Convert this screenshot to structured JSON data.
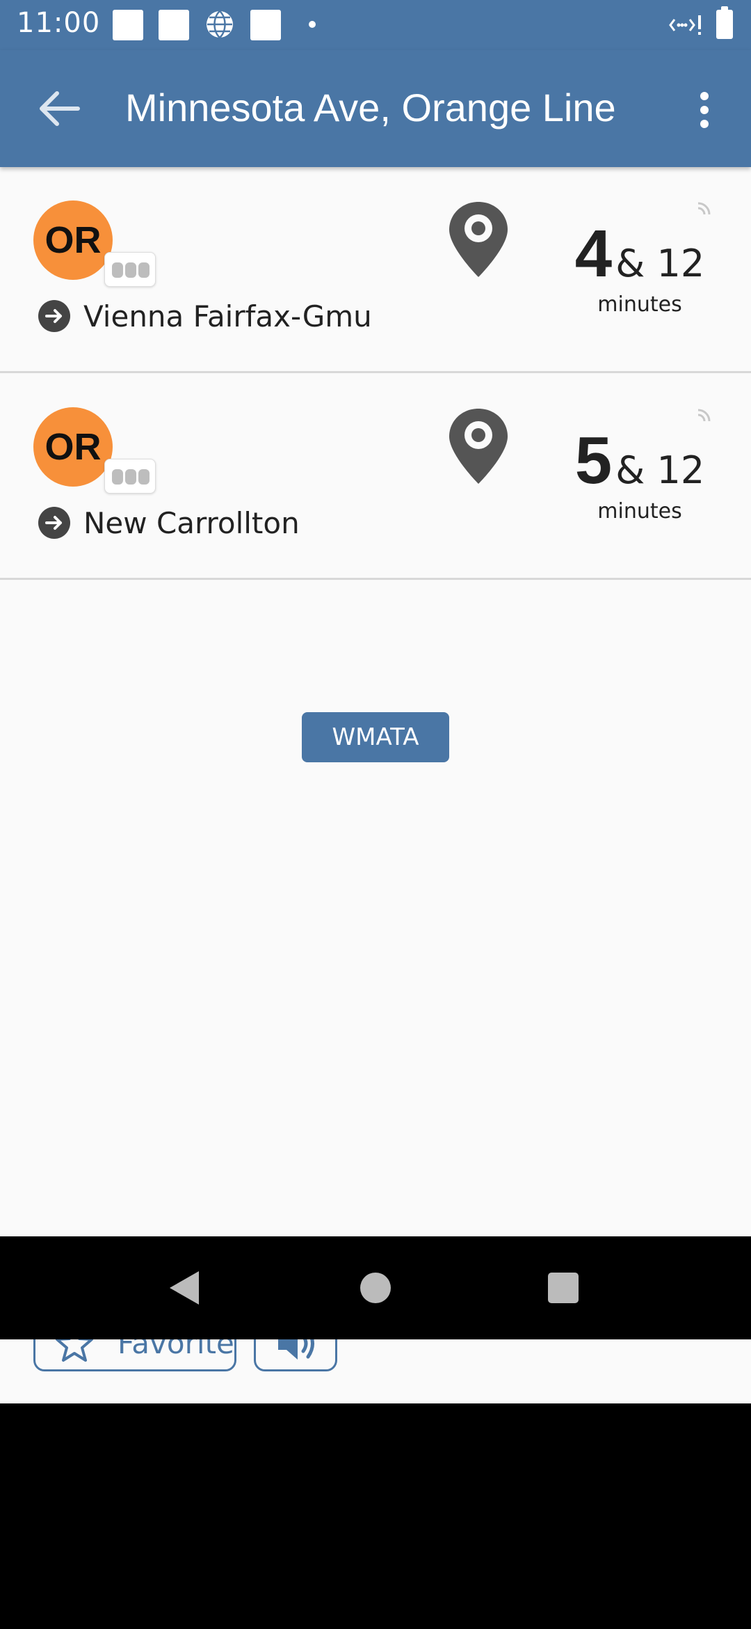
{
  "status_bar": {
    "time": "11:00"
  },
  "app_bar": {
    "title": "Minnesota Ave, Orange Line"
  },
  "arrivals": [
    {
      "route": "OR",
      "route_color": "#F7903A",
      "destination": "Vienna Fairfax-Gmu",
      "next_minutes": "4",
      "following": "& 12",
      "unit": "minutes"
    },
    {
      "route": "OR",
      "route_color": "#F7903A",
      "destination": "New Carrollton",
      "next_minutes": "5",
      "following": "& 12",
      "unit": "minutes"
    }
  ],
  "agency_button": "WMATA",
  "bottom_actions": {
    "favorite_label": "Favorite"
  },
  "colors": {
    "accent": "#4A76A5",
    "route_orange": "#F7903A"
  }
}
